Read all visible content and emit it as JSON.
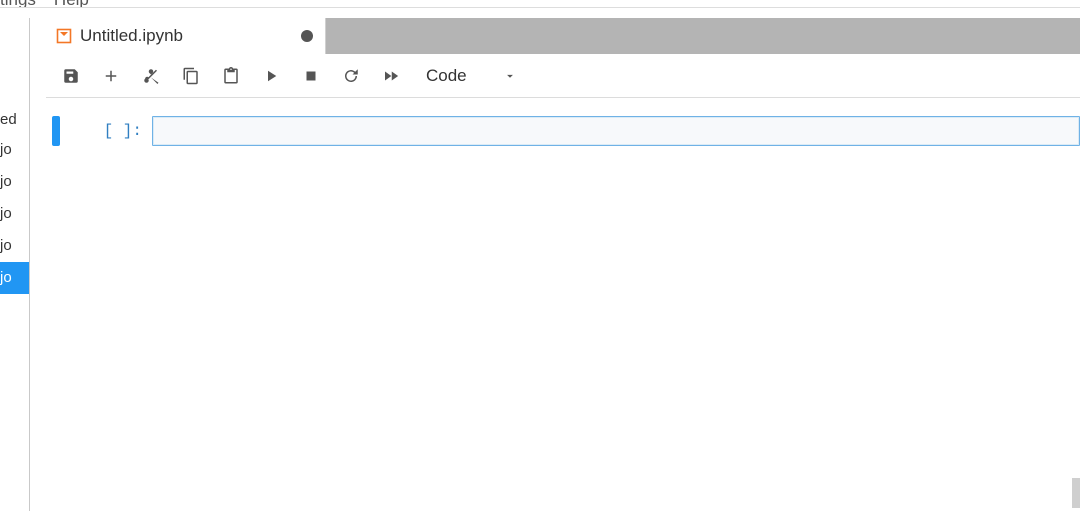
{
  "menubar": {
    "items": [
      "tings",
      "Help"
    ]
  },
  "sidebar": {
    "header": "ed",
    "rows": [
      {
        "text": "jo",
        "selected": false
      },
      {
        "text": "jo",
        "selected": false
      },
      {
        "text": "jo",
        "selected": false
      },
      {
        "text": "jo",
        "selected": false
      },
      {
        "text": "jo",
        "selected": true
      }
    ]
  },
  "tab": {
    "title": "Untitled.ipynb",
    "dirty": true
  },
  "toolbar": {
    "celltype": "Code"
  },
  "cells": [
    {
      "prompt": "[ ]:",
      "source": ""
    }
  ],
  "icons": {
    "notebook": "notebook-icon",
    "save": "save-icon",
    "add": "add-icon",
    "cut": "cut-icon",
    "copy": "copy-icon",
    "paste": "paste-icon",
    "run": "run-icon",
    "stop": "stop-icon",
    "restart": "restart-icon",
    "ff": "fast-forward-icon",
    "chevron": "chevron-down-icon"
  },
  "colors": {
    "accent": "#2196f3",
    "tabbar_bg": "#b4b4b4",
    "cell_border": "#6fb2e6"
  }
}
